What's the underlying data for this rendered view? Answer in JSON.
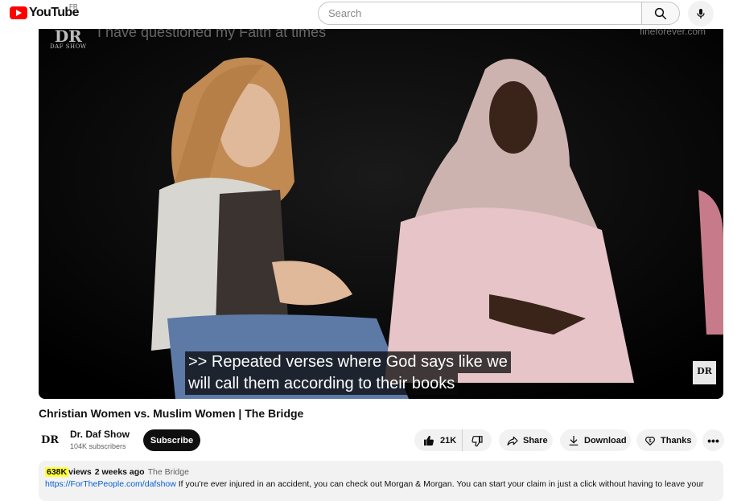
{
  "header": {
    "logo_text": "YouTube",
    "region": "FR",
    "search_placeholder": "Search",
    "brand_color": "#ff0000"
  },
  "player": {
    "watermark_logo": "DR",
    "watermark_sub": "DAF SHOW",
    "overlay_title": "I have questioned my Faith at times",
    "overlay_site": "fineforever.com",
    "caption_line1": ">> Repeated verses where God says like we",
    "caption_line2": "will call them according to their books",
    "corner_logo": "DR"
  },
  "video": {
    "title": "Christian Women vs. Muslim Women | The Bridge"
  },
  "channel": {
    "avatar_text": "DR",
    "name": "Dr. Daf Show",
    "subscribers": "104K subscribers",
    "subscribe_label": "Subscribe"
  },
  "actions": {
    "likes": "21K",
    "share": "Share",
    "download": "Download",
    "thanks": "Thanks",
    "more": "•••"
  },
  "description": {
    "views": "638K",
    "views_suffix": "views",
    "posted": "2 weeks ago",
    "tag": "The Bridge",
    "link": "https://ForThePeople.com/dafshow",
    "text": "If you're ever injured in an accident, you can check out Morgan & Morgan. You can start your claim in just a click without having to leave your"
  }
}
